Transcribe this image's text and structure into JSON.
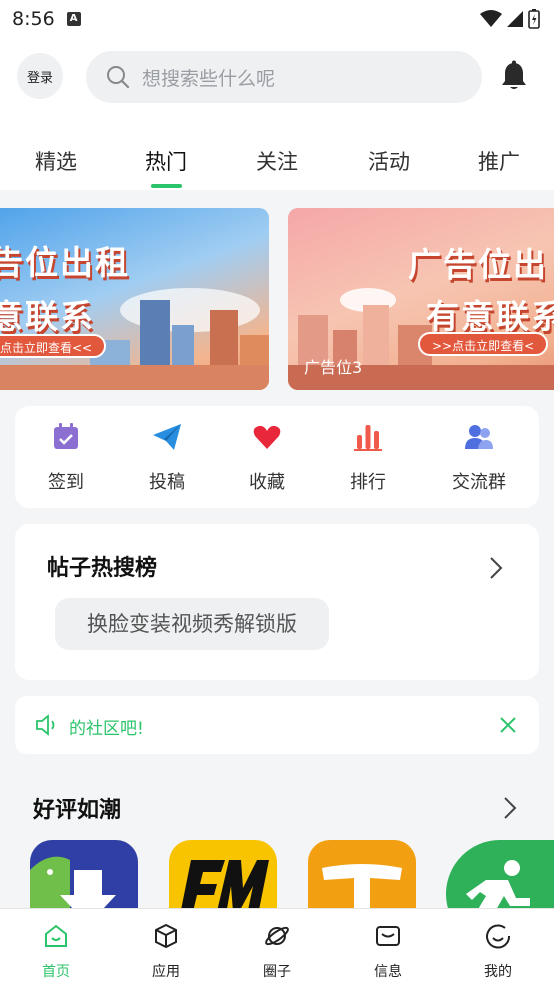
{
  "status": {
    "time": "8:56",
    "notif_letter": "A"
  },
  "header": {
    "login_label": "登录",
    "search_placeholder": "想搜索些什么呢"
  },
  "tabs": [
    {
      "label": "精选",
      "active": false
    },
    {
      "label": "热门",
      "active": true
    },
    {
      "label": "关注",
      "active": false
    },
    {
      "label": "活动",
      "active": false
    },
    {
      "label": "推广",
      "active": false
    }
  ],
  "banners": [
    {
      "title_line1": "告位出租",
      "title_line2": "意联系",
      "pill": "点击立即查看<<",
      "caption": ""
    },
    {
      "title_line1": "广告位出",
      "title_line2": "有意联系",
      "pill": ">>点击立即查看<",
      "caption": "广告位3"
    }
  ],
  "quick_actions": [
    {
      "label": "签到",
      "icon": "calendar-check-icon",
      "color": "#8b6fd1"
    },
    {
      "label": "投稿",
      "icon": "paper-plane-icon",
      "color": "#2a8ee0"
    },
    {
      "label": "收藏",
      "icon": "heart-icon",
      "color": "#e8273a"
    },
    {
      "label": "排行",
      "icon": "bar-chart-icon",
      "color": "#ef5a4a"
    },
    {
      "label": "交流群",
      "icon": "group-icon",
      "color": "#4f6fe0"
    }
  ],
  "hot_search": {
    "title": "帖子热搜榜",
    "chips": [
      "换脸变装视频秀解锁版"
    ]
  },
  "notice": {
    "text": "的社区吧!"
  },
  "good_reviews": {
    "title": "好评如潮"
  },
  "apps": [
    {
      "icon": "android-download-icon",
      "color": "#2f3fa5"
    },
    {
      "icon": "fm-logo-icon",
      "color": "#f8c400"
    },
    {
      "icon": "t-logo-icon",
      "color": "#f2a012"
    },
    {
      "icon": "runner-icon",
      "color": "#2fb15a"
    }
  ],
  "bottom_nav": [
    {
      "label": "首页",
      "icon": "home-icon",
      "active": true
    },
    {
      "label": "应用",
      "icon": "cube-icon",
      "active": false
    },
    {
      "label": "圈子",
      "icon": "planet-icon",
      "active": false
    },
    {
      "label": "信息",
      "icon": "mail-icon",
      "active": false
    },
    {
      "label": "我的",
      "icon": "smile-icon",
      "active": false
    }
  ],
  "colors": {
    "accent": "#2cc46a"
  }
}
